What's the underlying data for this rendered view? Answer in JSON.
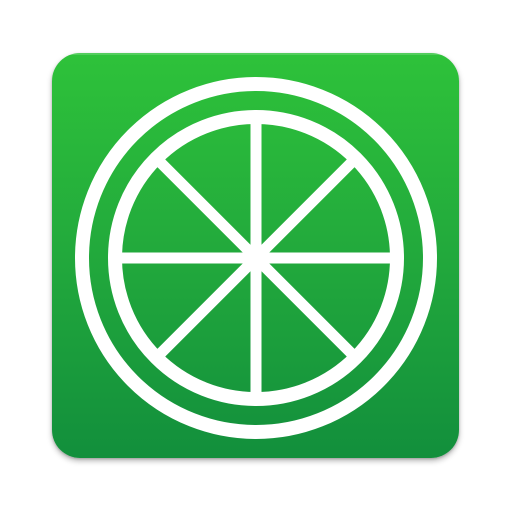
{
  "icon": {
    "name": "lime-slice-icon",
    "background_top": "#2ec23a",
    "background_bottom": "#128f3c",
    "glyph_color": "#ffffff"
  }
}
